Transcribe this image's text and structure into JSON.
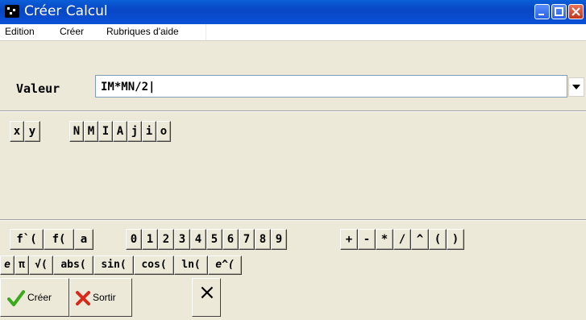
{
  "window": {
    "title": "Créer Calcul"
  },
  "menu": [
    "Edition",
    "Créer",
    "Rubriques d'aide"
  ],
  "valeur": {
    "label": "Valeur",
    "value": "IM*MN/2|"
  },
  "row1": [
    "x",
    "y",
    "N",
    "M",
    "I",
    "A",
    "j",
    "i",
    "o"
  ],
  "row2": [
    "f`(",
    "f(",
    "a",
    "0",
    "1",
    "2",
    "3",
    "4",
    "5",
    "6",
    "7",
    "8",
    "9",
    "+",
    "-",
    "*",
    "/",
    "^",
    "(",
    ")"
  ],
  "row3": [
    "e",
    "π",
    "√(",
    "abs(",
    "sin(",
    "cos(",
    "ln(",
    "e^("
  ],
  "buttons": {
    "create": "Créer",
    "exit": "Sortir",
    "clear": "×"
  },
  "colors": {
    "titlebar": "#0846c4",
    "check": "#3aa91b",
    "cross": "#d8281a"
  }
}
